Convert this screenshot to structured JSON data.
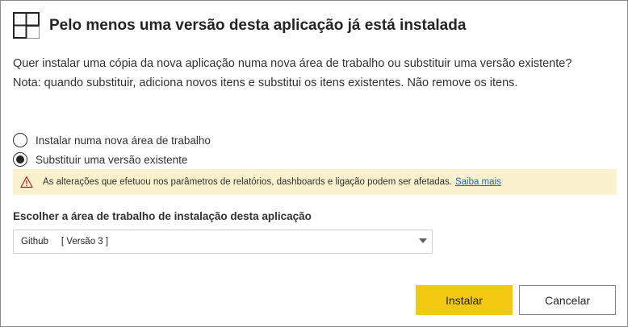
{
  "dialog": {
    "title": "Pelo menos uma versão desta aplicação já está instalada",
    "icon": "app-grid-icon",
    "description_line1": "Quer instalar uma cópia da nova aplicação numa nova área de trabalho ou substituir uma versão existente?",
    "description_line2": "Nota: quando substituir, adiciona novos itens e substitui os itens existentes. Não remove os itens."
  },
  "options": [
    {
      "label": "Instalar numa nova área de trabalho",
      "selected": false
    },
    {
      "label": "Substituir uma versão existente",
      "selected": true
    }
  ],
  "warning": {
    "icon": "warning-icon",
    "text": "As alterações que efetuou nos parâmetros de relatórios, dashboards e ligação podem ser afetadas.",
    "link": "Saiba mais",
    "color": "#fbf1cd"
  },
  "workspace": {
    "label": "Escolher a área de trabalho de instalação desta aplicação",
    "selected_name": "Github",
    "selected_version": "[ Versão 3 ]"
  },
  "buttons": {
    "install": "Instalar",
    "cancel": "Cancelar",
    "primary_color": "#f2c811"
  }
}
